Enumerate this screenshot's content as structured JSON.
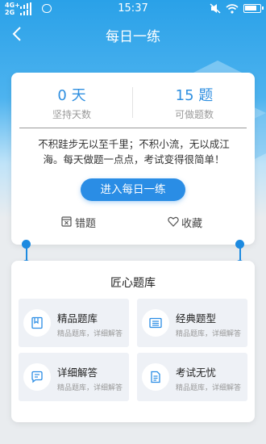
{
  "status_bar": {
    "network_top": "4G+",
    "network_bottom": "2G",
    "time": "15:37"
  },
  "header": {
    "title": "每日一练",
    "back_icon": "chevron-left-icon"
  },
  "stats": [
    {
      "value": "0 天",
      "label": "坚持天数"
    },
    {
      "value": "15 题",
      "label": "可做题数"
    }
  ],
  "quote": "不积跬步无以至千里；不积小流，无以成江海。每天做题一点点，考试变得很简单！",
  "enter_button": "进入每日一练",
  "links": {
    "wrong": {
      "label": "错题",
      "icon": "wrong-questions-icon"
    },
    "favorite": {
      "label": "收藏",
      "icon": "heart-icon"
    }
  },
  "library": {
    "title": "匠心题库",
    "items": [
      {
        "title": "精品题库",
        "subtitle": "精品题库，详细解答",
        "icon": "bookmark-book-icon"
      },
      {
        "title": "经典题型",
        "subtitle": "精品题库，详细解答",
        "icon": "list-card-icon"
      },
      {
        "title": "详细解答",
        "subtitle": "精品题库，详细解答",
        "icon": "chat-bubble-icon"
      },
      {
        "title": "考试无忧",
        "subtitle": "精品题库，详细解答",
        "icon": "document-icon"
      }
    ]
  },
  "colors": {
    "primary": "#2a8de5",
    "stat_number": "#2f8fe0",
    "header_gradient_top": "#2aa1e8"
  }
}
